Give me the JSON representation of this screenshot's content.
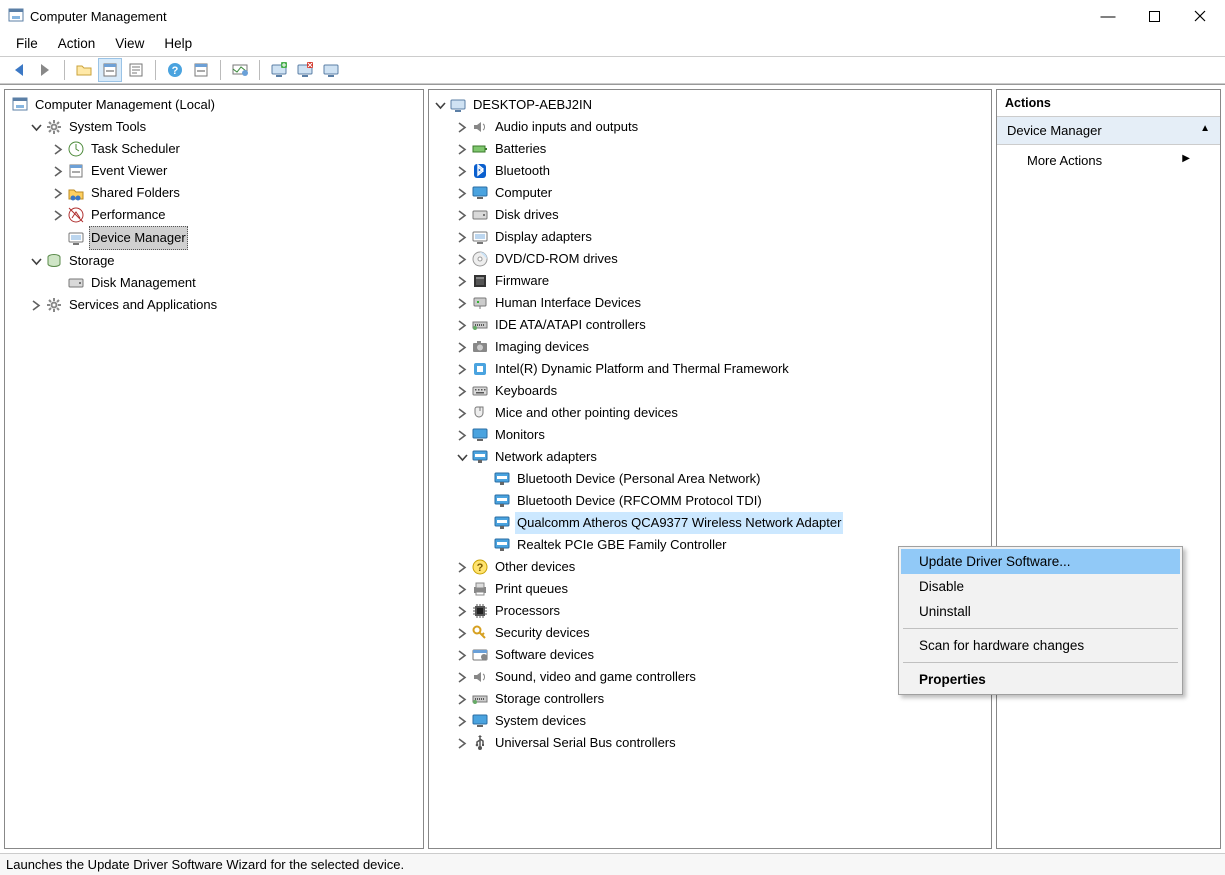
{
  "window": {
    "title": "Computer Management"
  },
  "menu": {
    "file": "File",
    "action": "Action",
    "view": "View",
    "help": "Help"
  },
  "left_tree": {
    "root": "Computer Management (Local)",
    "system_tools": "System Tools",
    "task_scheduler": "Task Scheduler",
    "event_viewer": "Event Viewer",
    "shared_folders": "Shared Folders",
    "performance": "Performance",
    "device_manager": "Device Manager",
    "storage": "Storage",
    "disk_management": "Disk Management",
    "services_apps": "Services and Applications"
  },
  "devmgr": {
    "host": "DESKTOP-AEBJ2IN",
    "audio": "Audio inputs and outputs",
    "batteries": "Batteries",
    "bluetooth": "Bluetooth",
    "computer": "Computer",
    "disk": "Disk drives",
    "display": "Display adapters",
    "dvd": "DVD/CD-ROM drives",
    "firmware": "Firmware",
    "hid": "Human Interface Devices",
    "ide": "IDE ATA/ATAPI controllers",
    "imaging": "Imaging devices",
    "intel_dptf": "Intel(R) Dynamic Platform and Thermal Framework",
    "keyboards": "Keyboards",
    "mice": "Mice and other pointing devices",
    "monitors": "Monitors",
    "network": "Network adapters",
    "net_bt_pan": "Bluetooth Device (Personal Area Network)",
    "net_bt_rfcomm": "Bluetooth Device (RFCOMM Protocol TDI)",
    "net_qca9377": "Qualcomm Atheros QCA9377 Wireless Network Adapter",
    "net_realtek": "Realtek PCIe GBE Family Controller",
    "other": "Other devices",
    "printq": "Print queues",
    "processors": "Processors",
    "security": "Security devices",
    "software": "Software devices",
    "sound": "Sound, video and game controllers",
    "storage_ctrl": "Storage controllers",
    "system": "System devices",
    "usb": "Universal Serial Bus controllers"
  },
  "actions": {
    "header": "Actions",
    "section": "Device Manager",
    "more": "More Actions"
  },
  "context_menu": {
    "update": "Update Driver Software...",
    "disable": "Disable",
    "uninstall": "Uninstall",
    "scan": "Scan for hardware changes",
    "properties": "Properties"
  },
  "status": "Launches the Update Driver Software Wizard for the selected device."
}
